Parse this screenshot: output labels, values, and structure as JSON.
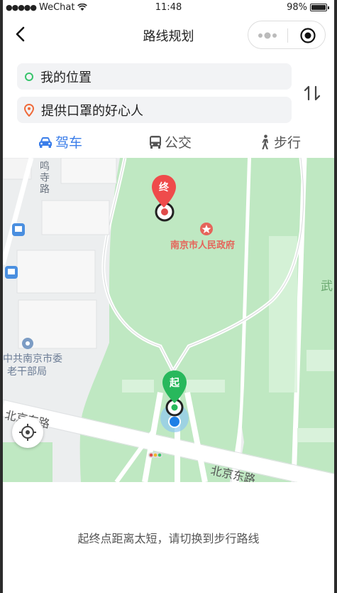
{
  "status_bar": {
    "signal_dots": "●●●●●",
    "carrier": "WeChat",
    "time": "11:48",
    "battery": "98%",
    "battery_level": 0.98
  },
  "navbar": {
    "title": "路线规划",
    "icons": {
      "back": "back-arrow-icon",
      "more": "more-dots-icon",
      "close": "target-circle-icon"
    }
  },
  "route": {
    "start_label": "我的位置",
    "end_label": "提供口罩的好心人",
    "start_color": "#37c46b",
    "end_color": "#ef6a3a"
  },
  "tabs": [
    {
      "label": "驾车",
      "icon": "car-icon",
      "active": true
    },
    {
      "label": "公交",
      "icon": "bus-icon",
      "active": false
    },
    {
      "label": "步行",
      "icon": "walk-icon",
      "active": false
    }
  ],
  "map": {
    "poi_government": "南京市人民政府",
    "poi_committee_line1": "中共南京市委",
    "poi_committee_line2": "老干部局",
    "road_beijing_east_1": "北京东路",
    "road_beijing_east_2": "北京东路",
    "road_mingsi": "鸣寺路",
    "edge_label": "武",
    "end_marker": "终",
    "start_marker": "起",
    "colors": {
      "park": "#bfe8c2",
      "road": "#ffffff",
      "end_marker": "#ef4b4b",
      "start_marker": "#28b85c"
    }
  },
  "message": "起终点距离太短，请切换到步行路线"
}
